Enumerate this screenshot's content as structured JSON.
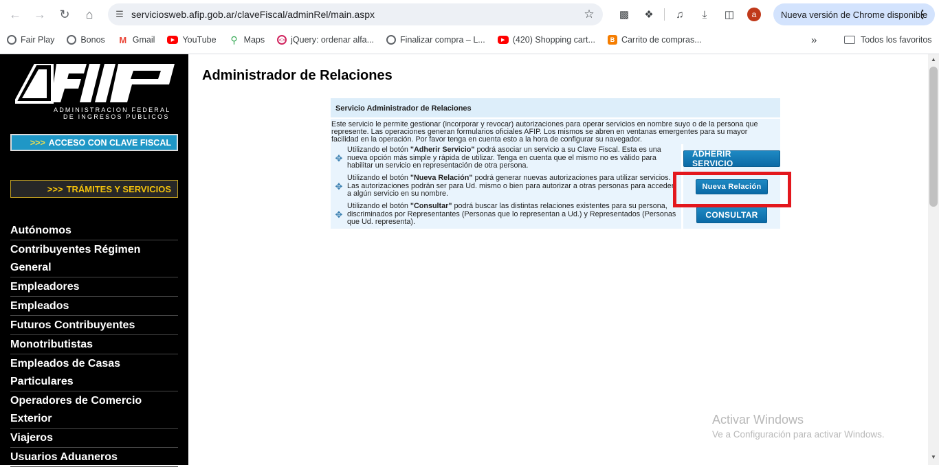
{
  "browser": {
    "url": "serviciosweb.afip.gob.ar/claveFiscal/adminRel/main.aspx",
    "update_label": "Nueva versión de Chrome disponible",
    "avatar_letter": "a",
    "bookmarks": [
      {
        "label": "Fair Play",
        "icon": "globe-icon"
      },
      {
        "label": "Bonos",
        "icon": "globe-icon"
      },
      {
        "label": "Gmail",
        "icon": "gmail-icon"
      },
      {
        "label": "YouTube",
        "icon": "youtube-icon"
      },
      {
        "label": "Maps",
        "icon": "maps-icon"
      },
      {
        "label": "jQuery: ordenar alfa...",
        "icon": "jquery-icon"
      },
      {
        "label": "Finalizar compra – L...",
        "icon": "globe-icon"
      },
      {
        "label": "(420) Shopping cart...",
        "icon": "youtube-icon"
      },
      {
        "label": "Carrito de compras...",
        "icon": "blogger-icon"
      }
    ],
    "all_bookmarks_label": "Todos los favoritos"
  },
  "sidebar": {
    "logo_line1": "ADMINISTRACION FEDERAL",
    "logo_line2": "DE INGRESOS PUBLICOS",
    "acceso_label": "ACCESO CON CLAVE FISCAL",
    "tramites_label": "TRÁMITES Y SERVICIOS",
    "menu": [
      "Autónomos",
      "Contribuyentes Régimen General",
      "Empleadores",
      "Empleados",
      "Futuros Contribuyentes",
      "Monotributistas",
      "Empleados de Casas Particulares",
      "Operadores de Comercio Exterior",
      "Viajeros",
      "Usuarios Aduaneros"
    ]
  },
  "main": {
    "title": "Administrador de Relaciones",
    "panel_header": "Servicio Administrador de Relaciones",
    "panel_desc": "Este servicio le permite gestionar (incorporar y revocar) autorizaciones para operar servicios en nombre suyo o de la persona que represente. Las operaciones generan formularios oficiales AFIP. Los mismos se abren en ventanas emergentes para su mayor facilidad en la operación. Por favor tenga en cuenta esto a la hora de configurar su navegador.",
    "rows": [
      {
        "pre": "Utilizando el botón ",
        "bold": "\"Adherir Servicio\"",
        "post": " podrá asociar un servicio a su Clave Fiscal. Esta es una nueva opción más simple y rápida de utilizar. Tenga en cuenta que el mismo no es válido para habilitar un servicio en representación de otra persona.",
        "button": "ADHERIR SERVICIO"
      },
      {
        "pre": "Utilizando el botón ",
        "bold": "\"Nueva Relación\"",
        "post": " podrá generar nuevas autorizaciones para utilizar servicios. Las autorizaciones podrán ser para Ud. mismo o bien para autorizar a otras personas para acceder a algún servicio en su nombre.",
        "button": "Nueva Relación"
      },
      {
        "pre": "Utilizando el botón ",
        "bold": "\"Consultar\"",
        "post": " podrá buscar las distintas relaciones existentes para su persona, discriminados por Representantes (Personas que lo representan a Ud.) y Representados (Personas que Ud. representa).",
        "button": "CONSULTAR"
      }
    ]
  },
  "watermark": {
    "line1": "Activar Windows",
    "line2": "Ve a Configuración para activar Windows."
  },
  "colors": {
    "highlight": "#e3171d",
    "button": "#0b6aa6",
    "panel_bg": "#e9f4fd"
  }
}
